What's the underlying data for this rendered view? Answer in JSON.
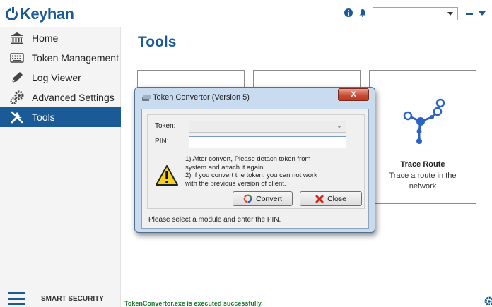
{
  "app": {
    "brand": "Keyhan",
    "footer_brand": "SMART SECURITY",
    "accent_color": "#1a5a96"
  },
  "topbar": {
    "icons": [
      "info-icon",
      "bell-icon"
    ],
    "user_select_value": ""
  },
  "sidebar": {
    "items": [
      {
        "label": "Home",
        "icon": "bank-icon"
      },
      {
        "label": "Token Management",
        "icon": "keyboard-icon"
      },
      {
        "label": "Log Viewer",
        "icon": "pen-icon"
      },
      {
        "label": "Advanced Settings",
        "icon": "gears-icon"
      },
      {
        "label": "Tools",
        "icon": "tools-icon",
        "active": true
      }
    ]
  },
  "main": {
    "title": "Tools",
    "cards": [
      {
        "title": "",
        "description": ""
      },
      {
        "title": "",
        "description": ""
      },
      {
        "title": "Trace Route",
        "description": "Trace a route in the network",
        "icon": "network-route-icon"
      }
    ],
    "status_message": "TokenConvertor.exe is executed successfully."
  },
  "dialog": {
    "title": "Token Convertor (Version 5)",
    "close_symbol": "X",
    "token_label": "Token:",
    "token_value": "",
    "pin_label": "PIN:",
    "pin_value": "",
    "warning_text": "1) After convert, Please detach token from system and attach it again.\n2) If you convert the token, you can not work with the previous version of client.",
    "warning_line1": "1) After convert, Please detach token from",
    "warning_line2": "system and attach it again.",
    "warning_line3": "2) If you convert the token, you can not work",
    "warning_line4": "with the previous version of client.",
    "convert_label": "Convert",
    "close_label": "Close",
    "status_text": "Please select a module and enter the PIN."
  }
}
